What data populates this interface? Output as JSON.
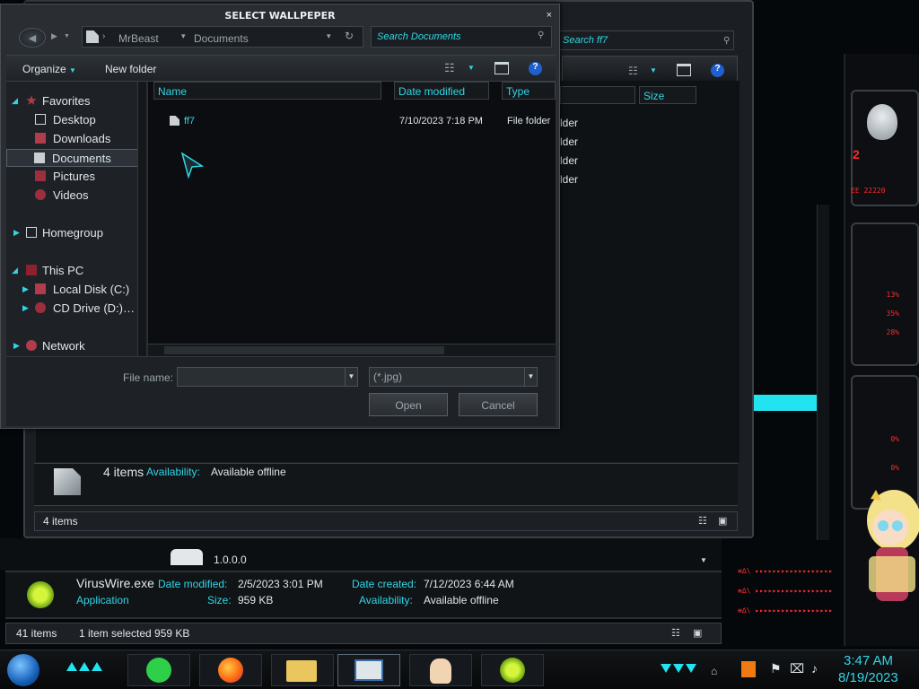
{
  "dialog": {
    "title": "SELECT WALLPEPER",
    "close": "×",
    "breadcrumb": [
      "MrBeast",
      "Documents"
    ],
    "search_placeholder": "Search Documents",
    "toolbar": {
      "organize": "Organize",
      "new_folder": "New folder"
    },
    "nav": {
      "favorites": "Favorites",
      "desktop": "Desktop",
      "downloads": "Downloads",
      "documents": "Documents",
      "pictures": "Pictures",
      "videos": "Videos",
      "homegroup": "Homegroup",
      "this_pc": "This PC",
      "local_disk": "Local Disk (C:)",
      "cd_drive": "CD Drive (D:) FF",
      "network": "Network"
    },
    "columns": {
      "name": "Name",
      "date": "Date modified",
      "type": "Type"
    },
    "files": [
      {
        "name": "ff7",
        "date": "7/10/2023 7:18 PM",
        "type": "File folder"
      }
    ],
    "file_name_label": "File name:",
    "file_name_value": "",
    "filter": "(*.jpg)",
    "open": "Open",
    "cancel": "Cancel"
  },
  "bg_window": {
    "search_placeholder": "Search ff7",
    "size_col": "Size",
    "type_fragments": [
      "lder",
      "lder",
      "lder",
      "lder"
    ],
    "details": {
      "count": "4 items",
      "availability_label": "Availability:",
      "availability": "Available offline"
    },
    "status": "4 items"
  },
  "main_window": {
    "version": "1.0.0.0",
    "details": {
      "name": "VirusWire.exe",
      "kind": "Application",
      "date_modified_label": "Date modified:",
      "date_modified": "2/5/2023 3:01 PM",
      "size_label": "Size:",
      "size": "959 KB",
      "date_created_label": "Date created:",
      "date_created": "7/12/2023 6:44 AM",
      "availability_label": "Availability:",
      "availability": "Available offline"
    },
    "status": {
      "items": "41 items",
      "selected": "1 item selected  959 KB"
    }
  },
  "gadget": {
    "top_value": "2",
    "rows": [
      "13%",
      "35%",
      "28%",
      "0%",
      "0%"
    ],
    "red_value": "EE 22220"
  },
  "taskbar": {
    "time": "3:47 AM",
    "date": "8/19/2023"
  },
  "colors": {
    "accent": "#2fd6e6",
    "alert": "#ff2a2a"
  }
}
